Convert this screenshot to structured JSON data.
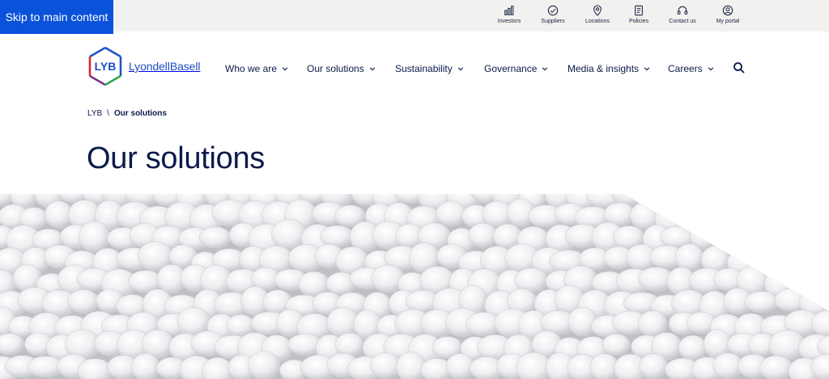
{
  "skip_link": "Skip to main content",
  "utility": [
    {
      "label": "Investors",
      "icon": "bar-chart-icon"
    },
    {
      "label": "Suppliers",
      "icon": "handshake-icon"
    },
    {
      "label": "Locations",
      "icon": "location-pin-icon"
    },
    {
      "label": "Policies",
      "icon": "document-icon"
    },
    {
      "label": "Contact us",
      "icon": "headset-icon"
    },
    {
      "label": "My portal",
      "icon": "user-icon"
    }
  ],
  "logo": {
    "mark": "LYB",
    "name": "LyondellBasell"
  },
  "nav": [
    {
      "label": "Who we are"
    },
    {
      "label": "Our solutions"
    },
    {
      "label": "Sustainability"
    },
    {
      "label": "Governance"
    },
    {
      "label": "Media & insights"
    },
    {
      "label": "Careers"
    }
  ],
  "breadcrumb": {
    "root": "LYB",
    "separator": "\\",
    "current": "Our solutions"
  },
  "title": "Our solutions",
  "colors": {
    "brand_blue": "#1d4fc4",
    "skip_blue": "#0a52d9",
    "navy": "#0a1a4a",
    "green": "#2aa84a",
    "red": "#d8232a"
  }
}
